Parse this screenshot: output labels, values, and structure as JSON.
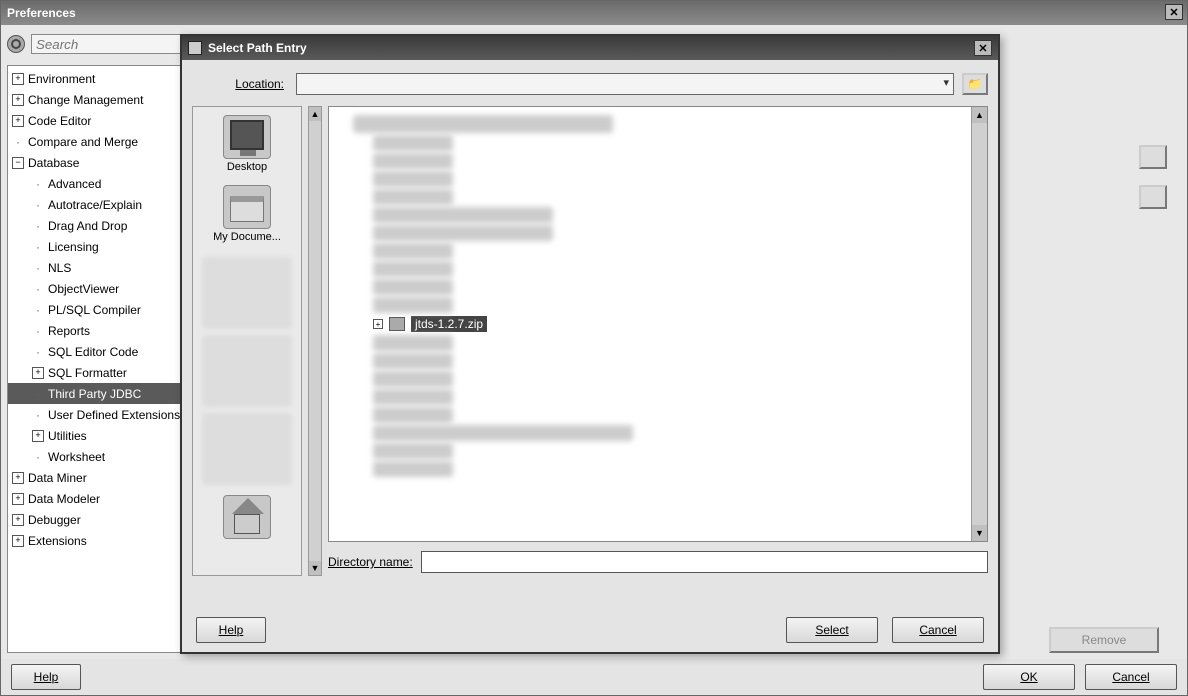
{
  "pref_window": {
    "title": "Preferences",
    "search_placeholder": "Search",
    "tree": [
      {
        "label": "Environment",
        "expand": "+",
        "indent": 0
      },
      {
        "label": "Change Management",
        "expand": "+",
        "indent": 0
      },
      {
        "label": "Code Editor",
        "expand": "+",
        "indent": 0
      },
      {
        "label": "Compare and Merge",
        "expand": "·",
        "indent": 0
      },
      {
        "label": "Database",
        "expand": "−",
        "indent": 0
      },
      {
        "label": "Advanced",
        "expand": "·",
        "indent": 1
      },
      {
        "label": "Autotrace/Explain",
        "expand": "·",
        "indent": 1
      },
      {
        "label": "Drag And Drop",
        "expand": "·",
        "indent": 1
      },
      {
        "label": "Licensing",
        "expand": "·",
        "indent": 1
      },
      {
        "label": "NLS",
        "expand": "·",
        "indent": 1
      },
      {
        "label": "ObjectViewer",
        "expand": "·",
        "indent": 1
      },
      {
        "label": "PL/SQL Compiler",
        "expand": "·",
        "indent": 1
      },
      {
        "label": "Reports",
        "expand": "·",
        "indent": 1
      },
      {
        "label": "SQL Editor Code",
        "expand": "·",
        "indent": 1
      },
      {
        "label": "SQL Formatter",
        "expand": "+",
        "indent": 1
      },
      {
        "label": "Third Party JDBC",
        "expand": "·",
        "indent": 1,
        "selected": true
      },
      {
        "label": "User Defined Extensions",
        "expand": "·",
        "indent": 1
      },
      {
        "label": "Utilities",
        "expand": "+",
        "indent": 1
      },
      {
        "label": "Worksheet",
        "expand": "·",
        "indent": 1
      },
      {
        "label": "Data Miner",
        "expand": "+",
        "indent": 0
      },
      {
        "label": "Data Modeler",
        "expand": "+",
        "indent": 0
      },
      {
        "label": "Debugger",
        "expand": "+",
        "indent": 0
      },
      {
        "label": "Extensions",
        "expand": "+",
        "indent": 0
      }
    ],
    "footer": {
      "help": "Help",
      "ok": "OK",
      "cancel": "Cancel"
    },
    "right": {
      "remove": "Remove"
    }
  },
  "dialog": {
    "title": "Select Path Entry",
    "location_label": "Location:",
    "location_value": "",
    "places": {
      "desktop": "Desktop",
      "mydocs": "My Docume...",
      "home": ""
    },
    "selected_file": "jtds-1.2.7.zip",
    "dir_label": "Directory name:",
    "dir_value": "",
    "footer": {
      "help": "Help",
      "select": "Select",
      "cancel": "Cancel"
    }
  }
}
